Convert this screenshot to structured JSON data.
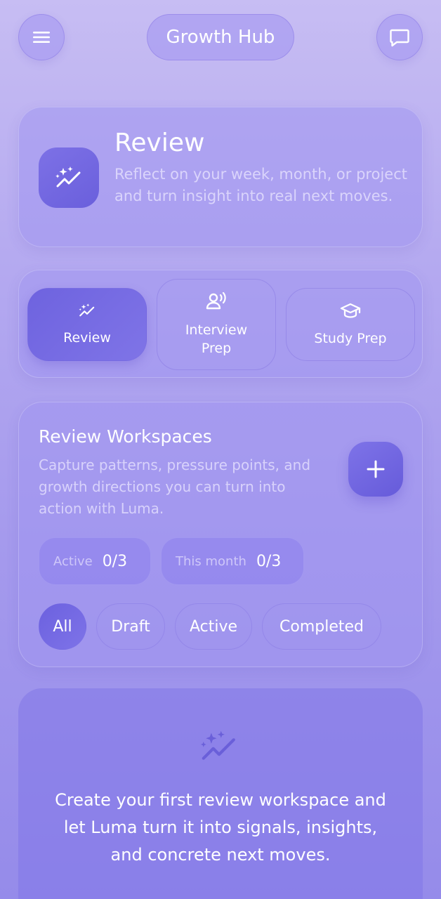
{
  "header": {
    "title": "Growth Hub",
    "menu_icon": "hamburger-menu-icon",
    "chat_icon": "chat-bubble-icon"
  },
  "hero": {
    "title": "Review",
    "description": "Reflect on your week, month, or project and turn insight into real next moves.",
    "icon": "sparkle-trend-icon"
  },
  "tabs": [
    {
      "label": "Review",
      "icon": "sparkle-trend-icon",
      "active": true
    },
    {
      "label": "Interview Prep",
      "icon": "person-speaking-icon",
      "active": false
    },
    {
      "label": "Study Prep",
      "icon": "graduation-cap-icon",
      "active": false
    }
  ],
  "workspaces": {
    "title": "Review Workspaces",
    "description": "Capture patterns, pressure points, and growth directions you can turn into action with Luma.",
    "add_icon": "plus-icon",
    "stats": [
      {
        "label": "Active",
        "value": "0/3"
      },
      {
        "label": "This month",
        "value": "0/3"
      }
    ],
    "filters": [
      {
        "label": "All",
        "active": true
      },
      {
        "label": "Draft",
        "active": false
      },
      {
        "label": "Active",
        "active": false
      },
      {
        "label": "Completed",
        "active": false
      }
    ]
  },
  "empty_state": {
    "icon": "sparkle-trend-icon",
    "message": "Create your first review workspace and let Luma turn it into signals, insights, and concrete next moves."
  },
  "colors": {
    "accent": "#6e63df",
    "background_top": "#c7bdf3",
    "background_bottom": "#958bea"
  }
}
